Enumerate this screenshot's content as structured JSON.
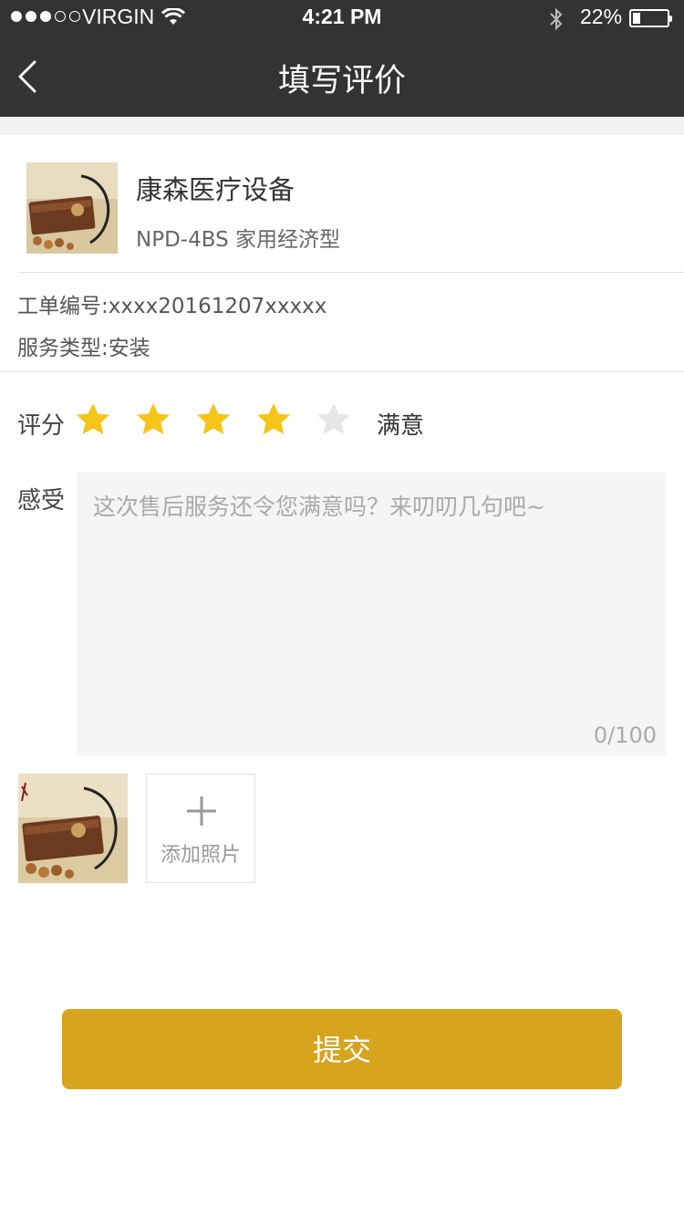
{
  "status_bar": {
    "carrier": "VIRGIN",
    "time": "4:21 PM",
    "battery_percent": "22%",
    "battery_level": 0.22,
    "signal_bars": 3,
    "signal_total": 5
  },
  "nav": {
    "title": "填写评价",
    "back_icon": "chevron-left-icon"
  },
  "product": {
    "name": "康森医疗设备",
    "model": "NPD-4BS 家用经济型"
  },
  "order": {
    "number_label": "工单编号:",
    "number_value": "xxxx20161207xxxxx",
    "service_label": "服务类型:",
    "service_value": "安装"
  },
  "rating": {
    "label": "评分",
    "value": 4,
    "max": 5,
    "text": "满意",
    "filled_color": "#f5c518",
    "empty_color": "#e6e6e6"
  },
  "feedback": {
    "label": "感受",
    "placeholder": "这次售后服务还令您满意吗？来叨叨几句吧~",
    "value": "",
    "counter": "0/100"
  },
  "photos": {
    "add_label": "添加照片"
  },
  "submit": {
    "label": "提交",
    "color": "#d6a41d"
  }
}
